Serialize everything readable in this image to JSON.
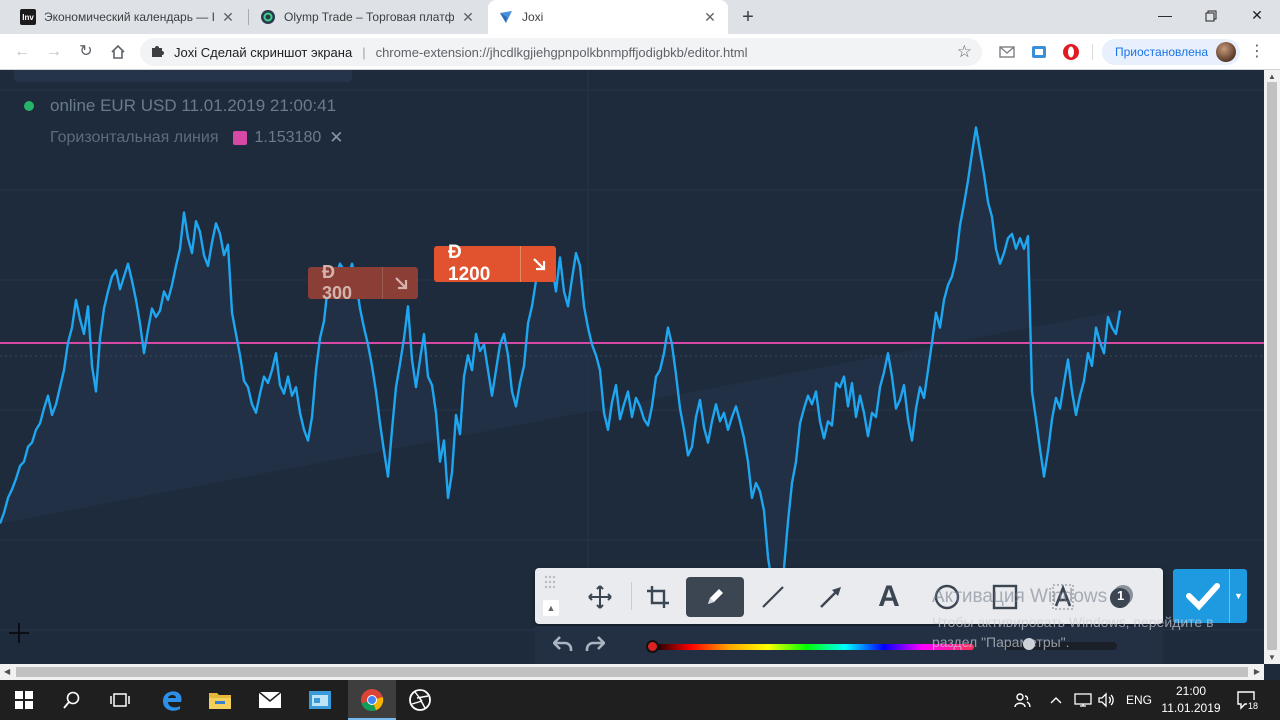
{
  "browser": {
    "tabs": [
      {
        "title": "Экономический календарь — Inv",
        "favicon_text": "Inv",
        "favicon_color": "#1b1b1b",
        "active": false
      },
      {
        "title": "Olymp Trade – Торговая платформа",
        "favicon_text": "",
        "favicon_color": "#2a3a4c",
        "active": false
      },
      {
        "title": "Joxi",
        "favicon_text": "",
        "favicon_color": "#4a90d9",
        "active": true
      }
    ],
    "new_tab_label": "+",
    "omnibox": {
      "extension_name": "Joxi Сделай скриншот экрана",
      "separator": "|",
      "url": "chrome-extension://jhcdlkgjiehgpnpolkbnmpffjodigbkb/editor.html"
    },
    "profile_label": "Приостановлена"
  },
  "chart": {
    "status_text": "online EUR USD 11.01.2019 21:00:41",
    "status_color": "#26b36a",
    "drawing_label": "Горизонтальная линия",
    "drawing_color": "#d64aa6",
    "drawing_value": "1.153180",
    "remove_icon": "✕",
    "line_color": "#1ea6f0",
    "hline_color": "#d64aa6",
    "deals": [
      {
        "amount": "Đ 1200",
        "direction": "down"
      },
      {
        "amount": "Đ 300",
        "direction": "down"
      }
    ]
  },
  "chart_data": {
    "type": "line",
    "x": [
      0,
      4,
      8,
      12,
      16,
      20,
      24,
      28,
      32,
      36,
      40,
      44,
      48,
      52,
      56,
      60,
      64,
      68,
      72,
      76,
      80,
      84,
      88,
      92,
      96,
      100,
      104,
      108,
      112,
      116,
      120,
      124,
      128,
      132,
      136,
      140,
      144,
      148,
      152,
      156,
      160,
      164,
      168,
      172,
      176,
      180,
      184,
      188,
      192,
      196,
      200,
      204,
      208,
      212,
      216,
      220,
      224,
      228,
      232,
      236,
      240,
      244,
      248,
      252,
      256,
      260,
      264,
      268,
      272,
      276,
      280,
      284,
      288,
      292,
      296,
      300,
      304,
      308,
      312,
      316,
      320,
      324,
      328,
      332,
      336,
      340,
      344,
      348,
      352,
      356,
      360,
      364,
      368,
      372,
      376,
      380,
      384,
      388,
      392,
      396,
      400,
      404,
      408,
      412,
      416,
      420,
      424,
      428,
      432,
      436,
      440,
      444,
      448,
      452,
      456,
      460,
      464,
      468,
      472,
      476,
      480,
      484,
      488,
      492,
      496,
      500,
      504,
      508,
      512,
      516,
      520,
      524,
      528,
      532,
      536,
      540,
      544,
      548,
      552,
      556,
      560,
      564,
      568,
      572,
      576,
      580,
      584,
      588,
      592,
      596,
      600,
      604,
      608,
      612,
      616,
      620,
      624,
      628,
      632,
      636,
      640,
      644,
      648,
      652,
      656,
      660,
      664,
      668,
      672,
      676,
      680,
      684,
      688,
      692,
      696,
      700,
      704,
      708,
      712,
      716,
      720,
      724,
      728,
      732,
      736,
      740,
      744,
      748,
      752,
      756,
      760,
      764,
      768,
      772,
      776,
      780,
      784,
      788,
      792,
      796,
      800,
      804,
      808,
      812,
      816,
      820,
      824,
      828,
      832,
      836,
      840,
      844,
      848,
      852,
      856,
      860,
      864,
      868,
      872,
      876,
      880,
      884,
      888,
      892,
      896,
      900,
      904,
      908,
      912,
      916,
      920,
      924,
      928,
      932,
      936,
      940,
      944,
      948,
      952,
      956,
      960,
      964,
      968,
      972,
      976,
      980,
      984,
      988,
      992,
      996,
      1000,
      1004,
      1008,
      1012,
      1016,
      1020,
      1024,
      1028,
      1032,
      1036,
      1040,
      1044,
      1048,
      1052,
      1056,
      1060,
      1064,
      1068,
      1072,
      1076,
      1080,
      1084,
      1088,
      1092,
      1096,
      1100,
      1104,
      1108,
      1112,
      1116,
      1120,
      1124,
      1128,
      1132,
      1136,
      1140,
      1144,
      1148,
      1152,
      1156,
      1160,
      1164,
      1168,
      1172,
      1176,
      1180,
      1184,
      1188,
      1192,
      1196,
      1200,
      1204,
      1208,
      1212,
      1216,
      1220,
      1224,
      1228,
      1232,
      1236,
      1240,
      1244,
      1248,
      1252,
      1256,
      1260,
      1264
    ],
    "y": [
      1.1447,
      1.1452,
      1.1459,
      1.1463,
      1.1468,
      1.1474,
      1.1476,
      1.1483,
      1.1485,
      1.1491,
      1.1494,
      1.1501,
      1.1507,
      1.1498,
      1.1503,
      1.1511,
      1.1519,
      1.1532,
      1.1539,
      1.1552,
      1.1543,
      1.1536,
      1.1549,
      1.1521,
      1.1509,
      1.1534,
      1.1548,
      1.1556,
      1.1563,
      1.1566,
      1.1557,
      1.1563,
      1.1569,
      1.1561,
      1.1552,
      1.1541,
      1.1527,
      1.1538,
      1.1548,
      1.1544,
      1.1547,
      1.1556,
      1.1552,
      1.1559,
      1.1568,
      1.1576,
      1.1593,
      1.1581,
      1.1574,
      1.1589,
      1.1584,
      1.1573,
      1.1568,
      1.1579,
      1.1588,
      1.1583,
      1.1573,
      1.1578,
      1.1546,
      1.1536,
      1.1526,
      1.1514,
      1.1511,
      1.1503,
      1.1499,
      1.1508,
      1.1516,
      1.1513,
      1.1519,
      1.1527,
      1.1512,
      1.1508,
      1.1516,
      1.1507,
      1.1511,
      1.1499,
      1.1491,
      1.1486,
      1.1497,
      1.1519,
      1.1534,
      1.1542,
      1.1559,
      1.1556,
      1.1563,
      1.1569,
      1.1566,
      1.1563,
      1.1569,
      1.1561,
      1.1548,
      1.1539,
      1.1531,
      1.1521,
      1.1509,
      1.1494,
      1.1481,
      1.1469,
      1.1491,
      1.1511,
      1.1522,
      1.1534,
      1.1549,
      1.1524,
      1.1511,
      1.1524,
      1.1536,
      1.1516,
      1.1512,
      1.1499,
      1.1476,
      1.1486,
      1.1459,
      1.1471,
      1.1498,
      1.1489,
      1.1516,
      1.1526,
      1.1519,
      1.1536,
      1.1528,
      1.1531,
      1.1519,
      1.1507,
      1.1519,
      1.1531,
      1.1536,
      1.1526,
      1.1509,
      1.1502,
      1.1513,
      1.1521,
      1.1541,
      1.1549,
      1.1561,
      1.1565,
      1.1563,
      1.1566,
      1.1568,
      1.1556,
      1.1572,
      1.1556,
      1.1549,
      1.1562,
      1.1574,
      1.1568,
      1.1549,
      1.1539,
      1.1531,
      1.1526,
      1.1519,
      1.1499,
      1.1491,
      1.1504,
      1.1512,
      1.1496,
      1.1503,
      1.1509,
      1.1497,
      1.1506,
      1.1502,
      1.1496,
      1.1493,
      1.1502,
      1.1516,
      1.1519,
      1.1527,
      1.1539,
      1.1531,
      1.1517,
      1.1501,
      1.1491,
      1.1479,
      1.1483,
      1.1497,
      1.1505,
      1.1492,
      1.1485,
      1.1495,
      1.1503,
      1.1495,
      1.1499,
      1.1491,
      1.1497,
      1.1502,
      1.1495,
      1.1487,
      1.1476,
      1.1459,
      1.1466,
      1.1462,
      1.1453,
      1.1431,
      1.1419,
      1.1422,
      1.1409,
      1.1426,
      1.1448,
      1.1466,
      1.1476,
      1.1494,
      1.1501,
      1.1507,
      1.1503,
      1.1509,
      1.1495,
      1.1487,
      1.1495,
      1.1493,
      1.1513,
      1.1511,
      1.1516,
      1.1502,
      1.1513,
      1.1497,
      1.1507,
      1.1499,
      1.1488,
      1.1499,
      1.1497,
      1.1511,
      1.1518,
      1.1527,
      1.1516,
      1.1501,
      1.1505,
      1.1512,
      1.1496,
      1.1486,
      1.1501,
      1.1511,
      1.1506,
      1.1519,
      1.1532,
      1.1546,
      1.1539,
      1.1552,
      1.1559,
      1.1563,
      1.1571,
      1.1587,
      1.1597,
      1.1608,
      1.1621,
      1.1633,
      1.1622,
      1.1611,
      1.1598,
      1.1591,
      1.1576,
      1.1569,
      1.1574,
      1.1581,
      1.1583,
      1.1576,
      1.1581,
      1.1576,
      1.1582,
      1.1509,
      1.1496,
      1.1482,
      1.1469,
      1.1481,
      1.1496,
      1.1506,
      1.1501,
      1.1513,
      1.1524,
      1.1509,
      1.1498,
      1.1507,
      1.1514,
      1.1527,
      1.1521,
      1.1539,
      1.1532,
      1.1527,
      1.1544,
      1.1539,
      1.1536,
      1.1547
    ],
    "hline": 1.15318,
    "title": "",
    "xlabel": "",
    "ylabel": "",
    "ylim": [
      1.1381,
      1.166
    ],
    "grid": true
  },
  "joxi": {
    "tools": [
      {
        "name": "move",
        "active": false
      },
      {
        "name": "crop",
        "active": false
      },
      {
        "name": "pencil",
        "active": true
      },
      {
        "name": "line",
        "active": false
      },
      {
        "name": "arrow",
        "active": false
      },
      {
        "name": "text",
        "active": false
      },
      {
        "name": "ellipse",
        "active": false
      },
      {
        "name": "rectangle",
        "active": false
      },
      {
        "name": "text-highlight",
        "active": false
      },
      {
        "name": "number",
        "active": false
      }
    ],
    "confirm_color": "#1e9be0",
    "number_label": "1",
    "text_tool_label": "A"
  },
  "windows_watermark": {
    "line1": "Активация Windows",
    "line2": "Чтобы активировать Windows, перейдите в",
    "line3": "раздел \"Параметры\"."
  },
  "taskbar": {
    "language": "ENG",
    "time": "21:00",
    "date": "11.01.2019",
    "notifications_count": "18"
  }
}
